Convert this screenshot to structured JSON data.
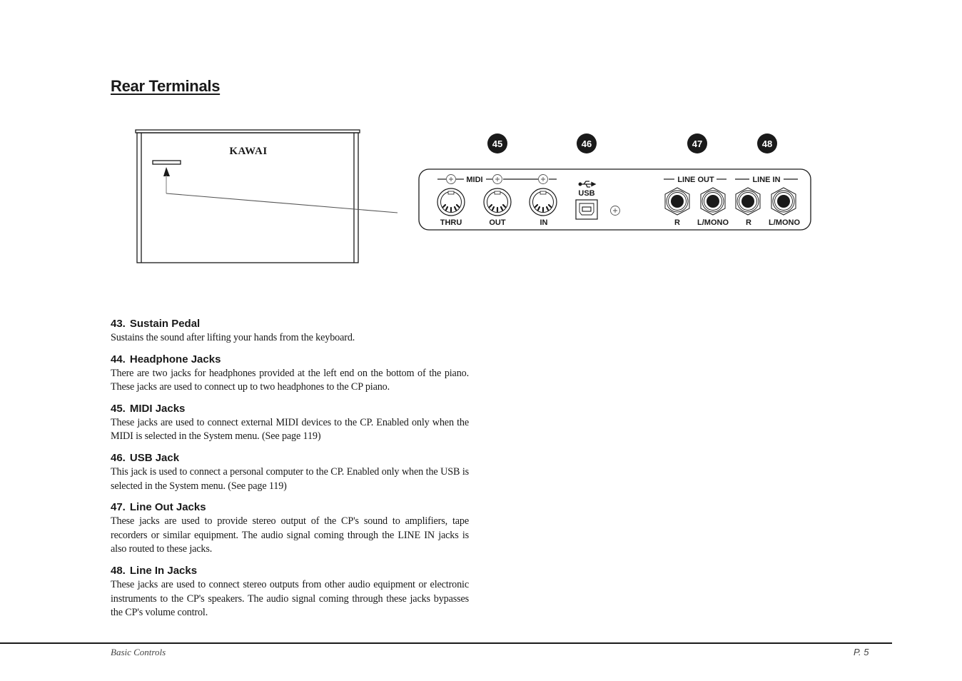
{
  "page": {
    "title": "Rear Terminals",
    "footer_left": "Basic Controls",
    "footer_right": "P. 5"
  },
  "diagram": {
    "brand": "KAWAI",
    "callouts": [
      "45",
      "46",
      "47",
      "48"
    ],
    "midi_group_label": "MIDI",
    "midi_ports": [
      "THRU",
      "OUT",
      "IN"
    ],
    "usb_label": "USB",
    "line_out_label": "LINE OUT",
    "line_in_label": "LINE IN",
    "line_out_ports": [
      "R",
      "L/MONO"
    ],
    "line_in_ports": [
      "R",
      "L/MONO"
    ]
  },
  "sections": [
    {
      "number": "43.",
      "title": "Sustain Pedal",
      "body": "Sustains the sound after lifting your hands from the keyboard."
    },
    {
      "number": "44.",
      "title": "Headphone Jacks",
      "body": "There are two jacks for headphones provided at the left end on the bottom of the piano.  These jacks are used to connect up to two headphones to the CP piano."
    },
    {
      "number": "45.",
      "title": "MIDI Jacks",
      "body": "These jacks are used to connect external MIDI devices to the CP.  Enabled only when the MIDI is selected in the System menu.  (See page 119)"
    },
    {
      "number": "46.",
      "title": "USB Jack",
      "body": "This jack is used to connect a personal computer to the CP.  Enabled only when the USB is selected in the System menu.  (See page 119)"
    },
    {
      "number": "47.",
      "title": "Line Out Jacks",
      "body": "These jacks are used to provide stereo output of the CP's sound to amplifiers, tape recorders or similar equipment.  The audio signal coming through the LINE IN jacks is also routed to these jacks."
    },
    {
      "number": "48.",
      "title": "Line In Jacks",
      "body": "These jacks are used to connect stereo outputs from other audio equipment or electronic instruments to the CP's speakers.  The audio signal coming through these jacks bypasses the CP's volume control."
    }
  ]
}
